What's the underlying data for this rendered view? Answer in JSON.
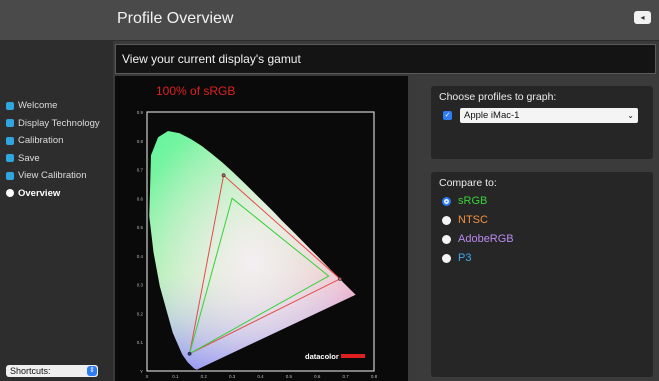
{
  "header": {
    "title": "Profile Overview",
    "back_icon": "◂"
  },
  "sidebar": {
    "steps": [
      {
        "label": "Welcome",
        "state": "done"
      },
      {
        "label": "Display Technology",
        "state": "done"
      },
      {
        "label": "Calibration",
        "state": "done"
      },
      {
        "label": "Save",
        "state": "done"
      },
      {
        "label": "View Calibration",
        "state": "done"
      },
      {
        "label": "Overview",
        "state": "current"
      }
    ],
    "shortcuts_label": "Shortcuts:"
  },
  "subheader": {
    "title": "View your current display's gamut"
  },
  "chart": {
    "coverage_label": "100% of sRGB",
    "brand": "datacolor",
    "y_ticks": [
      "0.9",
      "0.8",
      "0.7",
      "0.6",
      "0.5",
      "0.4",
      "0.3",
      "0.2",
      "0.1",
      "Y"
    ],
    "x_ticks": [
      "X",
      "0.1",
      "0.2",
      "0.3",
      "0.4",
      "0.5",
      "0.6",
      "0.7",
      "0.8"
    ]
  },
  "chart_data": {
    "type": "scatter",
    "title": "",
    "xlim": [
      0,
      0.8
    ],
    "ylim": [
      0,
      0.9
    ],
    "series": [
      {
        "name": "Apple iMac-1",
        "color": "#e84848",
        "points": [
          [
            0.68,
            0.32
          ],
          [
            0.27,
            0.68
          ],
          [
            0.15,
            0.06
          ]
        ]
      },
      {
        "name": "sRGB",
        "color": "#37d137",
        "points": [
          [
            0.64,
            0.33
          ],
          [
            0.3,
            0.6
          ],
          [
            0.15,
            0.06
          ]
        ]
      }
    ]
  },
  "profiles": {
    "title": "Choose profiles to graph:",
    "checked": true,
    "selected_profile": "Apple iMac-1"
  },
  "compare": {
    "title": "Compare to:",
    "options": [
      {
        "label": "sRGB",
        "color": "#3ad13a",
        "selected": true
      },
      {
        "label": "NTSC",
        "color": "#f29243",
        "selected": false
      },
      {
        "label": "AdobeRGB",
        "color": "#b98af0",
        "selected": false
      },
      {
        "label": "P3",
        "color": "#3fa9ee",
        "selected": false
      }
    ]
  }
}
